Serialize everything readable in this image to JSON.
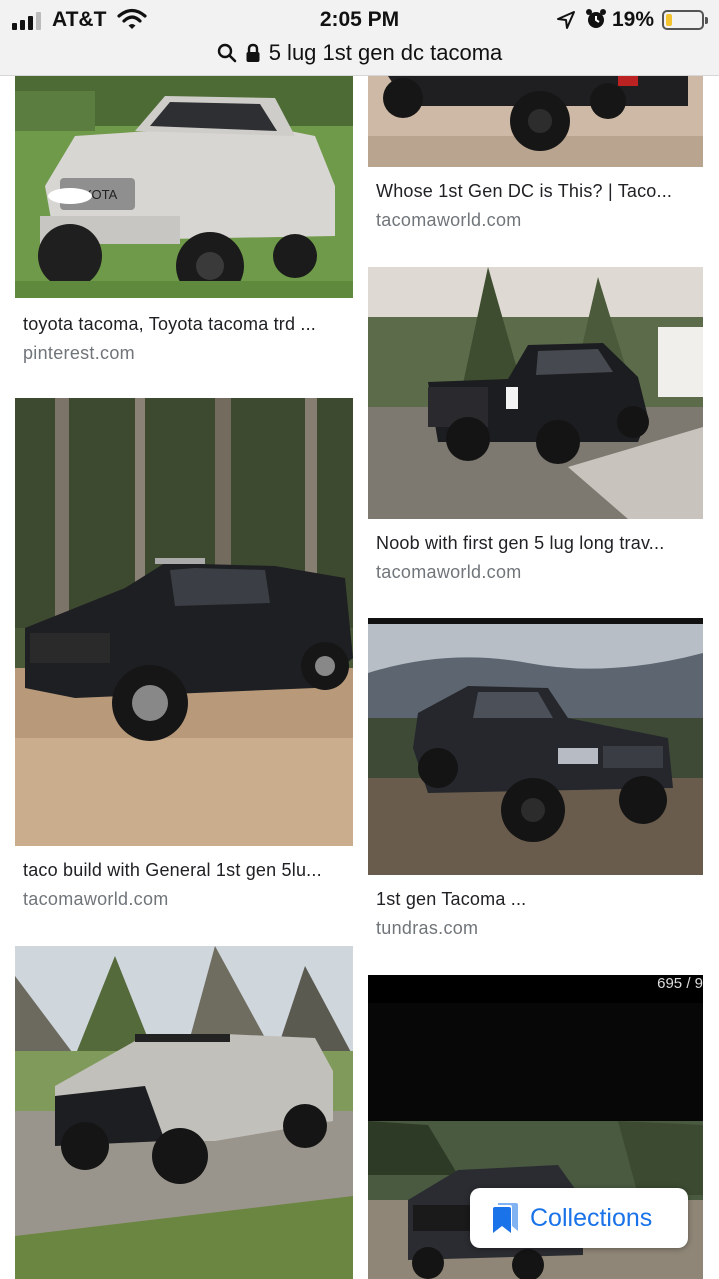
{
  "status_bar": {
    "carrier": "AT&T",
    "time": "2:05 PM",
    "battery_percent": "19%",
    "battery_level": 0.19,
    "icons": [
      "signal-icon",
      "wifi-icon",
      "location-icon",
      "alarm-icon",
      "battery-icon"
    ]
  },
  "url_bar": {
    "query": "5 lug 1st gen dc tacoma",
    "icons": [
      "search-icon",
      "lock-icon"
    ]
  },
  "results": {
    "left": [
      {
        "title": "toyota tacoma, Toyota tacoma trd ...",
        "source": "pinterest.com"
      },
      {
        "title": "taco build with General 1st gen 5lu...",
        "source": "tacomaworld.com"
      },
      {
        "title": "",
        "source": ""
      }
    ],
    "right": [
      {
        "title": "Whose 1st Gen DC is This? | Taco...",
        "source": "tacomaworld.com"
      },
      {
        "title": "Noob with first gen 5 lug long trav...",
        "source": "tacomaworld.com"
      },
      {
        "title": "1st gen Tacoma ...",
        "source": "tundras.com"
      },
      {
        "title": "",
        "source": "",
        "overlay_text": "695 / 9"
      }
    ]
  },
  "collections": {
    "label": "Collections",
    "icon": "bookmark-icon",
    "color": "#1a73e8"
  }
}
